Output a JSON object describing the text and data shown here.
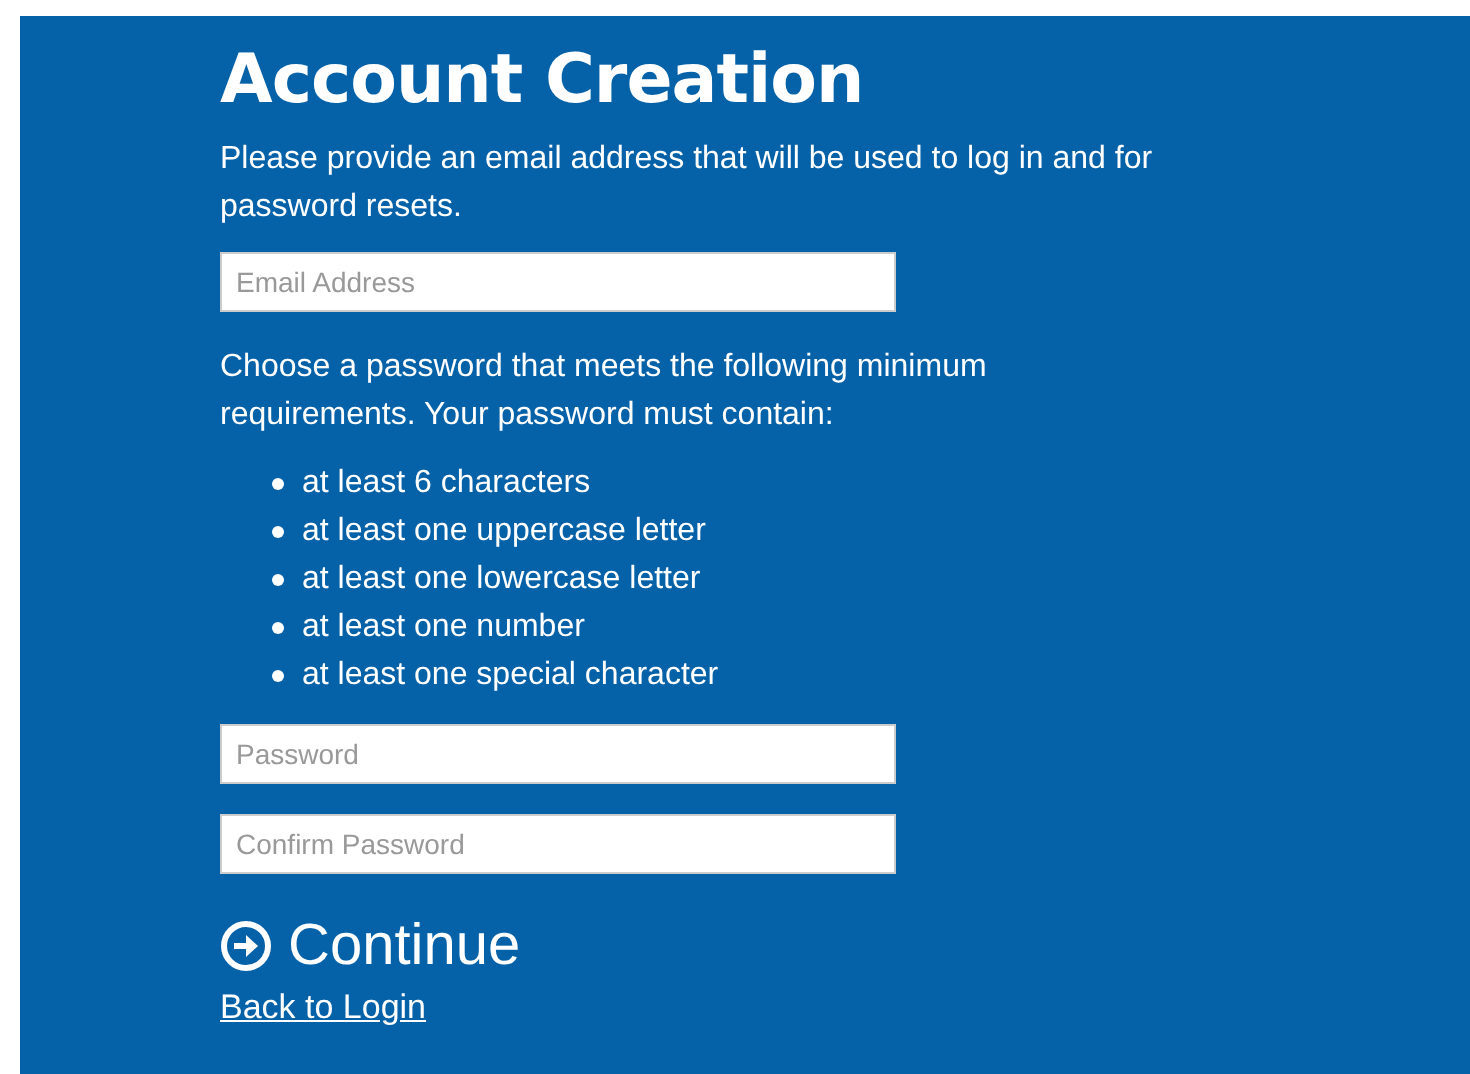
{
  "title": "Account Creation",
  "email_intro": "Please provide an email address that will be used to log in and for password resets.",
  "email_field": {
    "placeholder": "Email Address"
  },
  "password_intro": "Choose a password that meets the following minimum requirements. Your password must contain:",
  "requirements": [
    "at least 6 characters",
    "at least one uppercase letter",
    "at least one lowercase letter",
    "at least one number",
    "at least one special character"
  ],
  "password_field": {
    "placeholder": "Password"
  },
  "confirm_field": {
    "placeholder": "Confirm Password"
  },
  "continue_button": "Continue",
  "back_link": "Back to Login"
}
